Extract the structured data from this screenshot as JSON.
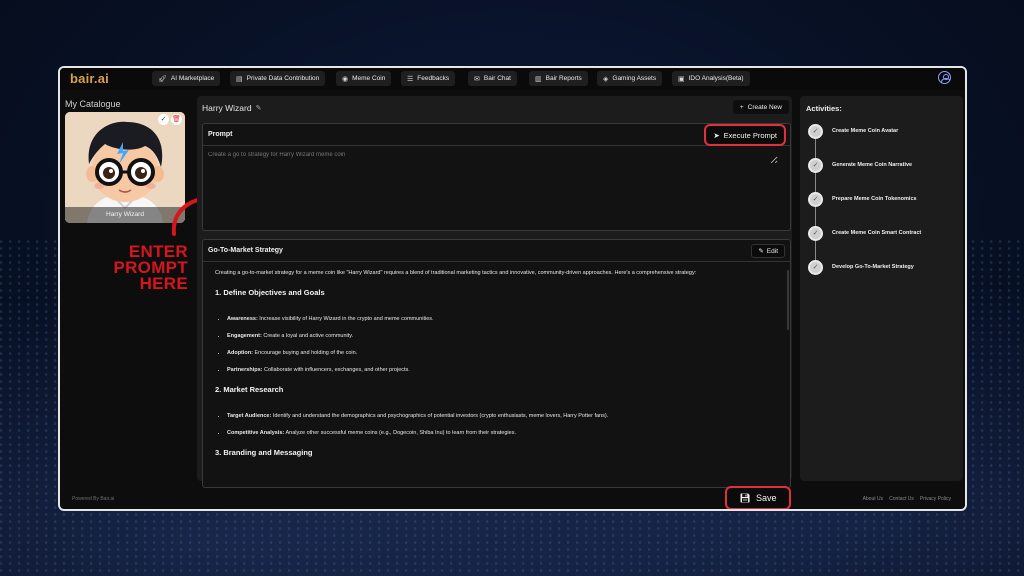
{
  "app": {
    "logo": "bair.ai"
  },
  "nav": [
    {
      "label": "AI Marketplace",
      "icon": "rocket-icon"
    },
    {
      "label": "Private Data Contribution",
      "icon": "document-icon"
    },
    {
      "label": "Meme Coin",
      "icon": "coins-icon"
    },
    {
      "label": "Feedbacks",
      "icon": "list-icon"
    },
    {
      "label": "Bair Chat",
      "icon": "chat-icon"
    },
    {
      "label": "Bair Reports",
      "icon": "chart-icon"
    },
    {
      "label": "Gaming Assets",
      "icon": "gamepad-icon"
    },
    {
      "label": "IDO Analysis(Beta)",
      "icon": "analysis-icon"
    }
  ],
  "catalogue": {
    "title": "My Catalogue",
    "card_name": "Harry Wizard"
  },
  "annotation": {
    "line1": "ENTER",
    "line2": "PROMPT",
    "line3": "HERE",
    "color": "#d4161d"
  },
  "editor": {
    "character_name": "Harry Wizard",
    "create_new_label": "Create New",
    "prompt_title": "Prompt",
    "execute_label": "Execute Prompt",
    "prompt_placeholder": "Create a go to strategy for Harry Wizard meme coin",
    "strategy_title": "Go-To-Market Strategy",
    "edit_label": "Edit",
    "intro": "Creating a go-to-market strategy for a meme coin like \"Harry Wizard\" requires a blend of traditional marketing tactics and innovative, community-driven approaches. Here's a comprehensive strategy:",
    "sections": [
      {
        "heading": "1. Define Objectives and Goals",
        "items": [
          {
            "term": "Awareness:",
            "text": " Increase visibility of Harry Wizard in the crypto and meme communities."
          },
          {
            "term": "Engagement:",
            "text": " Create a loyal and active community."
          },
          {
            "term": "Adoption:",
            "text": " Encourage buying and holding of the coin."
          },
          {
            "term": "Partnerships:",
            "text": " Collaborate with influencers, exchanges, and other projects."
          }
        ]
      },
      {
        "heading": "2. Market Research",
        "items": [
          {
            "term": "Target Audience:",
            "text": " Identify and understand the demographics and psychographics of potential investors (crypto enthusiasts, meme lovers, Harry Potter fans)."
          },
          {
            "term": "Competitive Analysis:",
            "text": " Analyze other successful meme coins (e.g., Dogecoin, Shiba Inu) to learn from their strategies."
          }
        ]
      },
      {
        "heading": "3. Branding and Messaging",
        "items": []
      }
    ]
  },
  "activities": {
    "title": "Activities:",
    "items": [
      "Create Meme Coin Avatar",
      "Generate Meme Coin Narrative",
      "Prepare Meme Coin Tokenomics",
      "Create Meme Coin Smart Contract",
      "Develop Go-To-Market Strategy"
    ]
  },
  "footer": {
    "powered": "Powered By Bair.ai",
    "save_label": "Save",
    "links": [
      "About Us",
      "Contact Us",
      "Privacy Policy"
    ]
  },
  "colors": {
    "accent": "#e0303a",
    "logo": "#d9a24a",
    "highlight": "#d4161d"
  }
}
